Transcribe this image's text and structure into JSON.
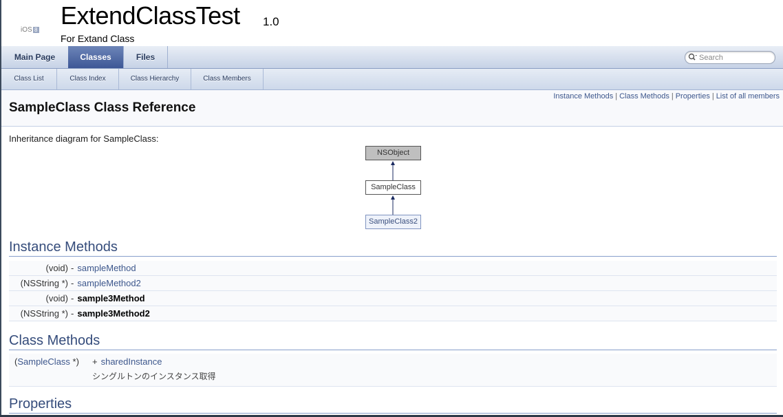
{
  "title_area": {
    "logo_text": "iOS",
    "logo_badge": "8",
    "project_name": "ExtendClassTest",
    "project_number": "1.0",
    "project_brief": "For Extand Class"
  },
  "main_tabs": [
    {
      "label": "Main Page",
      "current": false
    },
    {
      "label": "Classes",
      "current": true
    },
    {
      "label": "Files",
      "current": false
    }
  ],
  "search": {
    "placeholder": "Search"
  },
  "sub_tabs": [
    {
      "label": "Class List"
    },
    {
      "label": "Class Index"
    },
    {
      "label": "Class Hierarchy"
    },
    {
      "label": "Class Members"
    }
  ],
  "header": {
    "summary_links": [
      "Instance Methods",
      "Class Methods",
      "Properties",
      "List of all members"
    ],
    "separator": "|",
    "title": "SampleClass Class Reference"
  },
  "inheritance": {
    "text": "Inheritance diagram for SampleClass:",
    "nodes": [
      "NSObject",
      "SampleClass",
      "SampleClass2"
    ]
  },
  "instance_methods": {
    "heading": "Instance Methods",
    "items": [
      {
        "ret": "(void)",
        "sig": "-",
        "name": "sampleMethod",
        "linked": true
      },
      {
        "ret": "(NSString *)",
        "sig": "-",
        "name": "sampleMethod2",
        "linked": true
      },
      {
        "ret": "(void)",
        "sig": "-",
        "name": "sample3Method",
        "linked": false
      },
      {
        "ret": "(NSString *)",
        "sig": "-",
        "name": "sample3Method2",
        "linked": false
      }
    ]
  },
  "class_methods": {
    "heading": "Class Methods",
    "items": [
      {
        "ret_open": "(",
        "ret_type": "SampleClass",
        "ret_close": " *)",
        "sig": "+",
        "name": "sharedInstance",
        "desc": "シングルトンのインスタンス取得"
      }
    ]
  },
  "properties": {
    "heading": "Properties"
  },
  "colors": {
    "link": "#3d578c",
    "heading": "#354c7b",
    "tab_current": "#3d5796",
    "tab_bar": "#c6d2e6"
  },
  "icons": {
    "search": "magnifier-icon",
    "arrow": "inheritance-arrow-icon"
  }
}
